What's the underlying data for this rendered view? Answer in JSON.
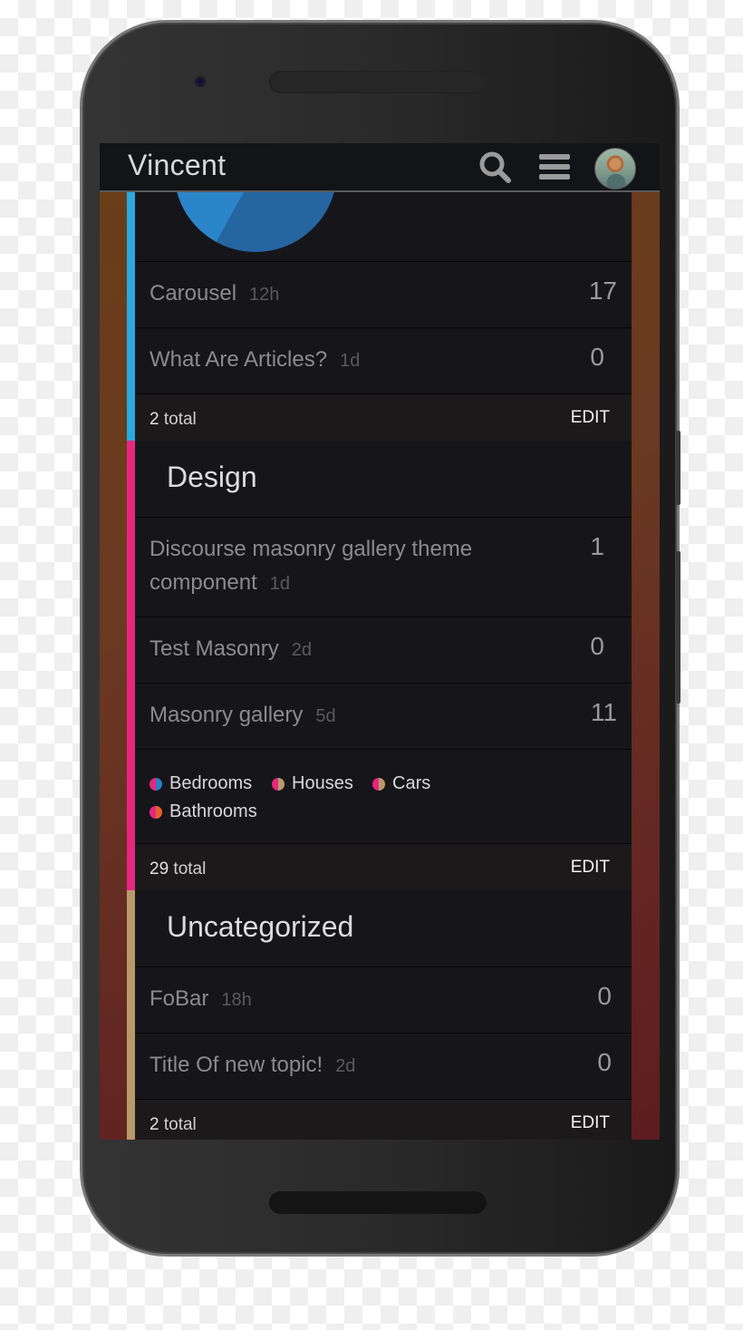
{
  "header": {
    "title": "Vincent",
    "icons": [
      "search-icon",
      "hamburger-menu-icon",
      "user-avatar"
    ]
  },
  "colors": {
    "category_blue": "#29a9e1",
    "category_design": "#e8267f",
    "category_uncategorized": "#b89a6a",
    "background_card": "#16161a"
  },
  "categories": [
    {
      "name": "",
      "stripe_color": "#29a9e1",
      "topics": [
        {
          "title": "Carousel",
          "age": "12h",
          "count": "17"
        },
        {
          "title": "What Are Articles?",
          "age": "1d",
          "count": "0"
        }
      ],
      "total_number": "2",
      "total_label": "total",
      "edit_label": "EDIT"
    },
    {
      "name": "Design",
      "stripe_color": "#e8267f",
      "topics": [
        {
          "title": "Discourse masonry gallery theme component",
          "age": "1d",
          "count": "1"
        },
        {
          "title": "Test Masonry",
          "age": "2d",
          "count": "0"
        },
        {
          "title": "Masonry gallery",
          "age": "5d",
          "count": "11"
        }
      ],
      "subcategories": [
        {
          "name": "Bedrooms",
          "colors": [
            "#e8267f",
            "#2a7fc4"
          ]
        },
        {
          "name": "Houses",
          "colors": [
            "#e8267f",
            "#b89a6a"
          ]
        },
        {
          "name": "Cars",
          "colors": [
            "#e8267f",
            "#b89a6a"
          ]
        },
        {
          "name": "Bathrooms",
          "colors": [
            "#e8267f",
            "#e8622a"
          ]
        }
      ],
      "total_number": "29",
      "total_label": "total",
      "edit_label": "EDIT"
    },
    {
      "name": "Uncategorized",
      "stripe_color": "#b89a6a",
      "topics": [
        {
          "title": "FoBar",
          "age": "18h",
          "count": "0"
        },
        {
          "title": "Title Of new topic!",
          "age": "2d",
          "count": "0"
        }
      ],
      "total_number": "2",
      "total_label": "total",
      "edit_label": "EDIT"
    }
  ]
}
